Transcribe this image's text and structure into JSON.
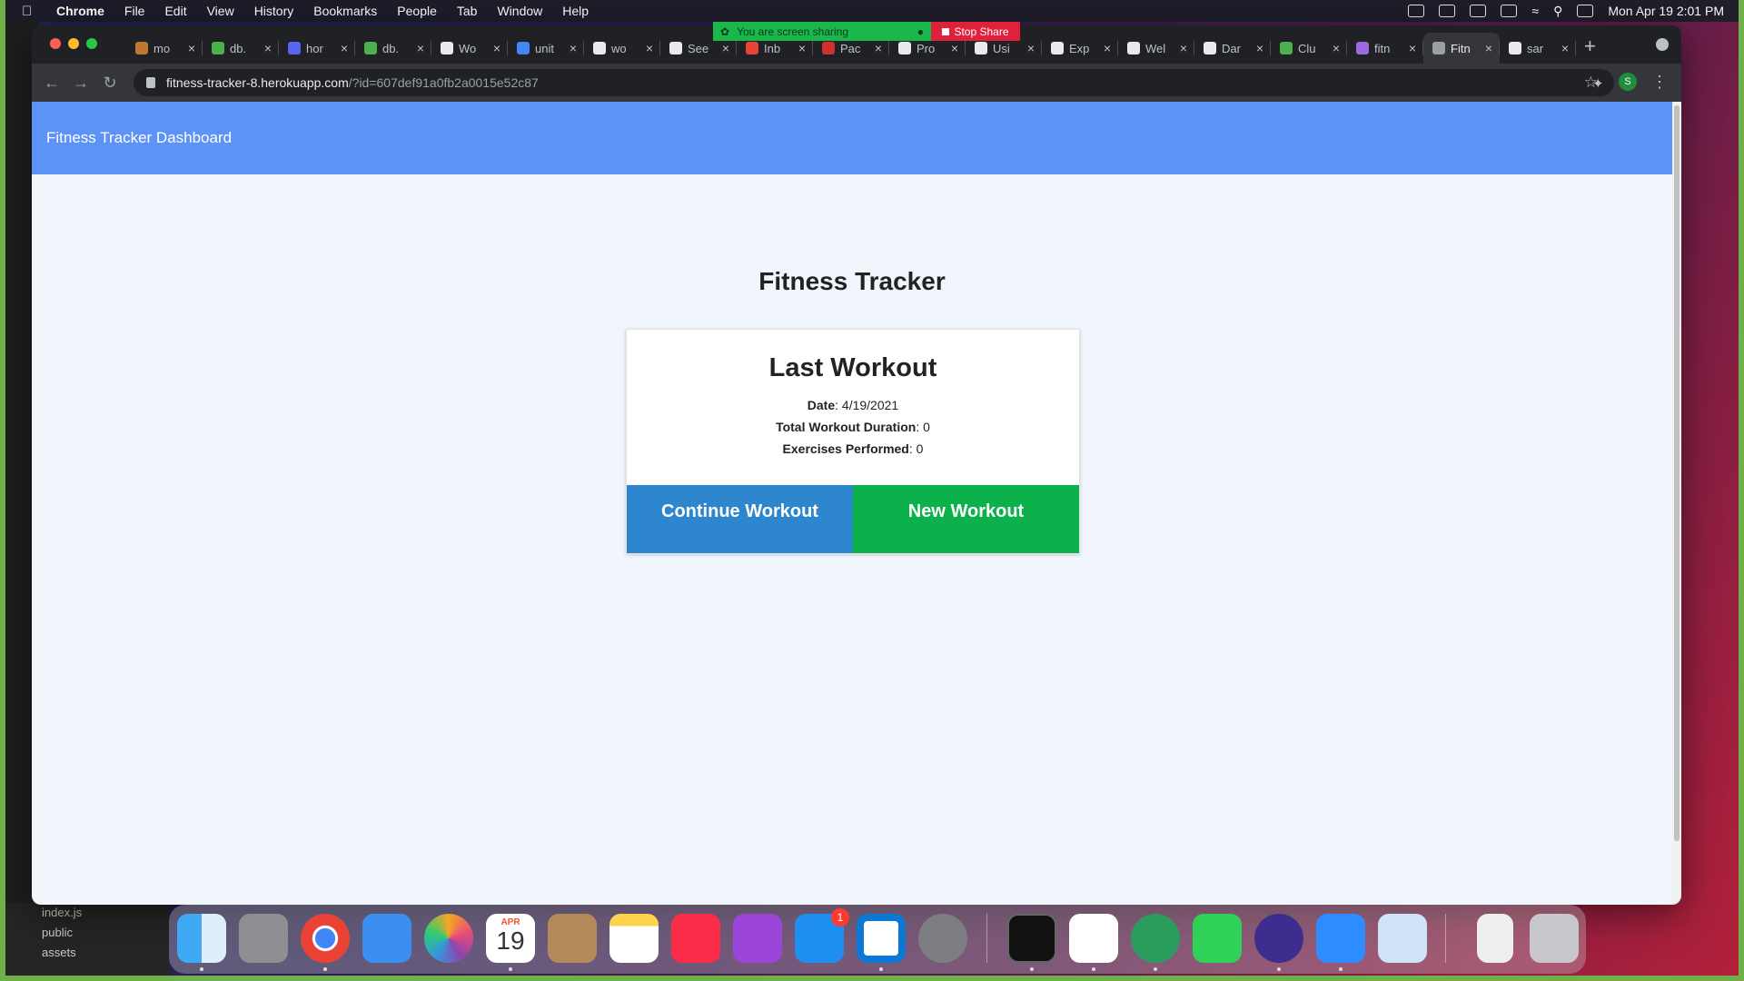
{
  "menubar": {
    "app_name": "Chrome",
    "items": [
      "File",
      "Edit",
      "View",
      "History",
      "Bookmarks",
      "People",
      "Tab",
      "Window",
      "Help"
    ],
    "datetime": "Mon Apr 19  2:01 PM"
  },
  "screen_share": {
    "status": "You are screen sharing",
    "stop_label": "Stop Share"
  },
  "browser": {
    "tabs": [
      {
        "label": "mo"
      },
      {
        "label": "db."
      },
      {
        "label": "hor"
      },
      {
        "label": "db."
      },
      {
        "label": "Wo"
      },
      {
        "label": "unit"
      },
      {
        "label": "wo"
      },
      {
        "label": "See"
      },
      {
        "label": "Inb"
      },
      {
        "label": "Pac"
      },
      {
        "label": "Pro"
      },
      {
        "label": "Usi"
      },
      {
        "label": "Exp"
      },
      {
        "label": "Wel"
      },
      {
        "label": "Dar"
      },
      {
        "label": "Clu"
      },
      {
        "label": "fitn"
      },
      {
        "label": "Fitn"
      },
      {
        "label": "sar"
      }
    ],
    "active_tab_index": 17,
    "url_host": "fitness-tracker-8.herokuapp.com",
    "url_path": "/?id=607def91a0fb2a0015e52c87",
    "profile_initial": "S"
  },
  "page": {
    "navbar_brand": "Fitness Tracker Dashboard",
    "title": "Fitness Tracker",
    "card": {
      "heading": "Last Workout",
      "date_label": "Date",
      "date_value": ": 4/19/2021",
      "duration_label": "Total Workout Duration",
      "duration_value": ": 0",
      "exercises_label": "Exercises Performed",
      "exercises_value": ": 0",
      "continue_label": "Continue Workout",
      "new_label": "New Workout"
    }
  },
  "explorer": {
    "items": [
      "index.js",
      "public",
      "assets"
    ]
  },
  "dock": {
    "calendar_month": "APR",
    "calendar_day": "19",
    "appstore_badge": "1"
  }
}
